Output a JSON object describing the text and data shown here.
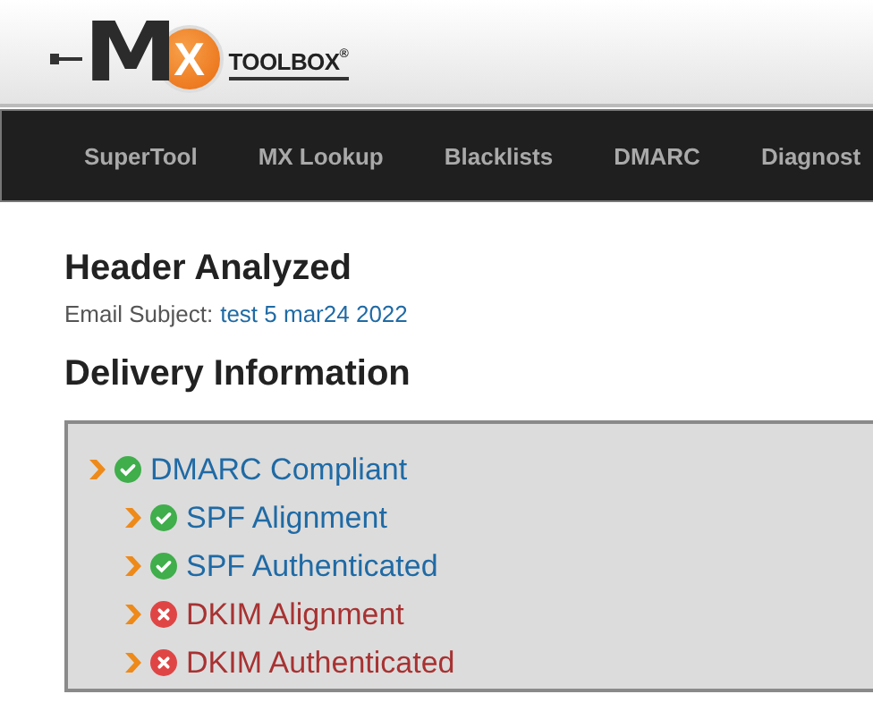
{
  "logo": {
    "mark": "M",
    "badge": "X",
    "wordmark": "TOOLBOX",
    "registered": "®"
  },
  "nav": [
    {
      "label": "SuperTool"
    },
    {
      "label": "MX Lookup"
    },
    {
      "label": "Blacklists"
    },
    {
      "label": "DMARC"
    },
    {
      "label": "Diagnost"
    }
  ],
  "title": "Header Analyzed",
  "subject": {
    "label": "Email Subject:",
    "value": "test 5 mar24 2022"
  },
  "section_title": "Delivery Information",
  "tree": [
    {
      "label": "DMARC Compliant",
      "kind": "pass",
      "children": [
        {
          "label": "SPF Alignment",
          "kind": "pass"
        },
        {
          "label": "SPF Authenticated",
          "kind": "pass"
        },
        {
          "label": "DKIM Alignment",
          "kind": "fail"
        },
        {
          "label": "DKIM Authenticated",
          "kind": "fail"
        }
      ]
    }
  ]
}
